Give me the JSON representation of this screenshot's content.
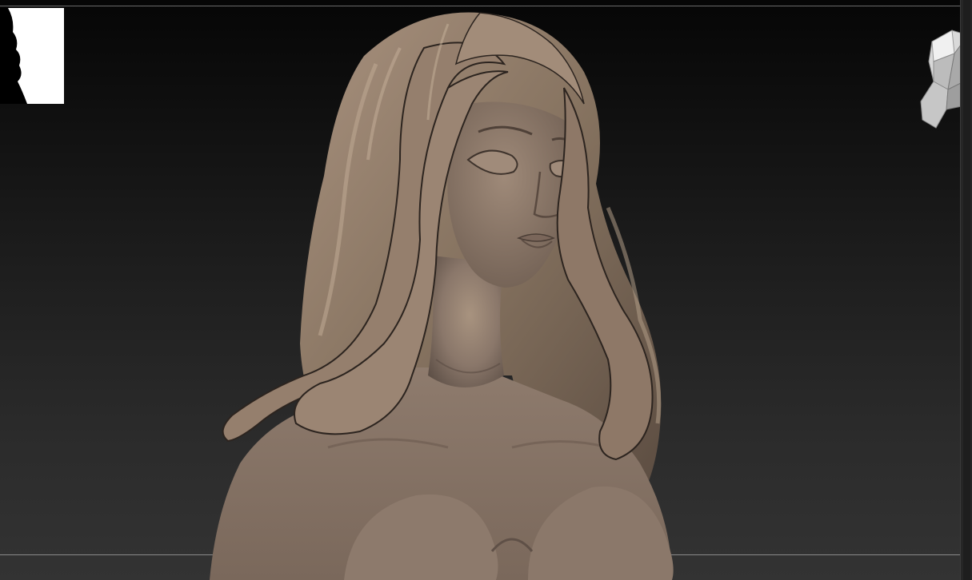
{
  "app": {
    "window": "ZBrush viewport"
  },
  "viewport": {
    "background_top": "#060606",
    "background_bottom": "#333333",
    "model_color": "#8c7a6c",
    "model_shadow": "#4a3e35",
    "model_highlight": "#b7a392"
  },
  "navigator": {
    "icon": "navigator-thumbnail-icon"
  },
  "gizmo": {
    "icon": "orientation-head-gizmo-icon",
    "marker_color": "#c8281e"
  }
}
